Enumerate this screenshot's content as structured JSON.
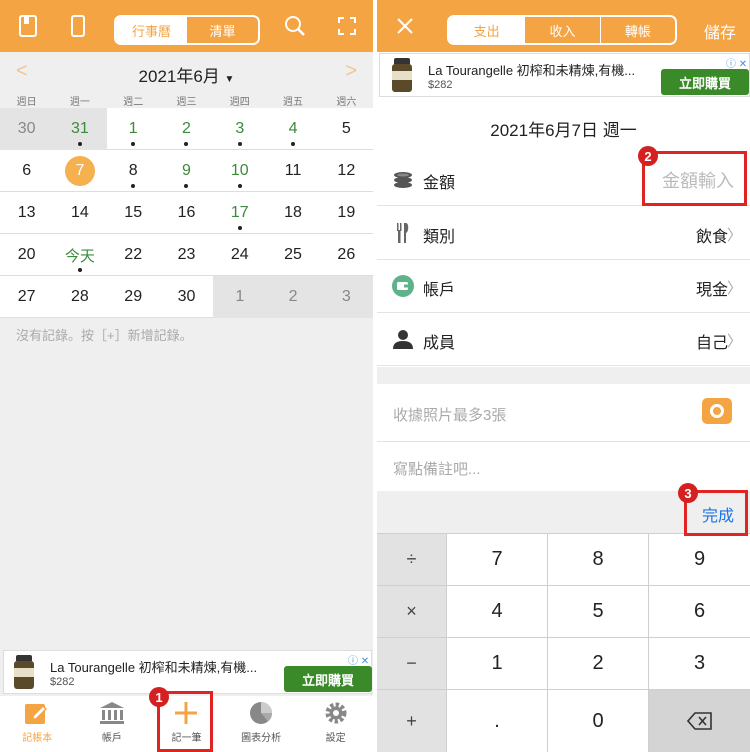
{
  "left": {
    "topbar": {
      "seg_calendar": "行事曆",
      "seg_list": "清單"
    },
    "calendar": {
      "month_title": "2021年6月",
      "weekdays": [
        "週日",
        "週一",
        "週二",
        "週三",
        "週四",
        "週五",
        "週六"
      ],
      "weeks": [
        [
          {
            "d": "30",
            "grey": true
          },
          {
            "d": "31",
            "grey": true,
            "green": true,
            "dot": true
          },
          {
            "d": "1",
            "green": true,
            "dot": true
          },
          {
            "d": "2",
            "green": true,
            "dot": true
          },
          {
            "d": "3",
            "green": true,
            "dot": true
          },
          {
            "d": "4",
            "green": true,
            "dot": true
          },
          {
            "d": "5"
          }
        ],
        [
          {
            "d": "6"
          },
          {
            "d": "7",
            "selected": true
          },
          {
            "d": "8",
            "dot": true
          },
          {
            "d": "9",
            "green": true,
            "dot": true
          },
          {
            "d": "10",
            "green": true,
            "dot": true
          },
          {
            "d": "11"
          },
          {
            "d": "12"
          }
        ],
        [
          {
            "d": "13"
          },
          {
            "d": "14"
          },
          {
            "d": "15"
          },
          {
            "d": "16"
          },
          {
            "d": "17",
            "green": true,
            "dot": true
          },
          {
            "d": "18"
          },
          {
            "d": "19"
          }
        ],
        [
          {
            "d": "20"
          },
          {
            "d": "今天",
            "green": true,
            "dot": true
          },
          {
            "d": "22"
          },
          {
            "d": "23"
          },
          {
            "d": "24"
          },
          {
            "d": "25"
          },
          {
            "d": "26"
          }
        ],
        [
          {
            "d": "27"
          },
          {
            "d": "28"
          },
          {
            "d": "29"
          },
          {
            "d": "30"
          },
          {
            "d": "1",
            "grey": true
          },
          {
            "d": "2",
            "grey": true
          },
          {
            "d": "3",
            "grey": true
          }
        ]
      ],
      "no_record": "沒有記錄。按［+］新增記錄。"
    },
    "ad": {
      "title": "La Tourangelle 初榨和未精煉,有機...",
      "price": "$282",
      "buy": "立即購買"
    },
    "nav": [
      {
        "label": "記帳本",
        "icon": "edit-icon"
      },
      {
        "label": "帳戶",
        "icon": "bank-icon"
      },
      {
        "label": "記一筆",
        "icon": "plus-icon"
      },
      {
        "label": "圖表分析",
        "icon": "pie-chart-icon"
      },
      {
        "label": "設定",
        "icon": "gear-icon"
      }
    ]
  },
  "right": {
    "topbar": {
      "seg_expense": "支出",
      "seg_income": "收入",
      "seg_transfer": "轉帳",
      "save": "儲存"
    },
    "ad": {
      "title": "La Tourangelle 初榨和未精煉,有機...",
      "price": "$282",
      "buy": "立即購買"
    },
    "date": "2021年6月7日 週一",
    "rows": {
      "amount_label": "金額",
      "amount_placeholder": "金額輸入",
      "category_label": "類別",
      "category_value": "飲食",
      "account_label": "帳戶",
      "account_value": "現金",
      "member_label": "成員",
      "member_value": "自己"
    },
    "photo_placeholder": "收據照片最多3張",
    "note_placeholder": "寫點備註吧...",
    "done": "完成",
    "keys": [
      "÷",
      "7",
      "8",
      "9",
      "×",
      "4",
      "5",
      "6",
      "−",
      "1",
      "2",
      "3",
      "+",
      ".",
      "0"
    ]
  },
  "badges": [
    "1",
    "2",
    "3"
  ],
  "colors": {
    "accent": "#f5a443",
    "highlight": "#e02424",
    "green": "#3c8a3c",
    "link": "#1a73e8"
  }
}
